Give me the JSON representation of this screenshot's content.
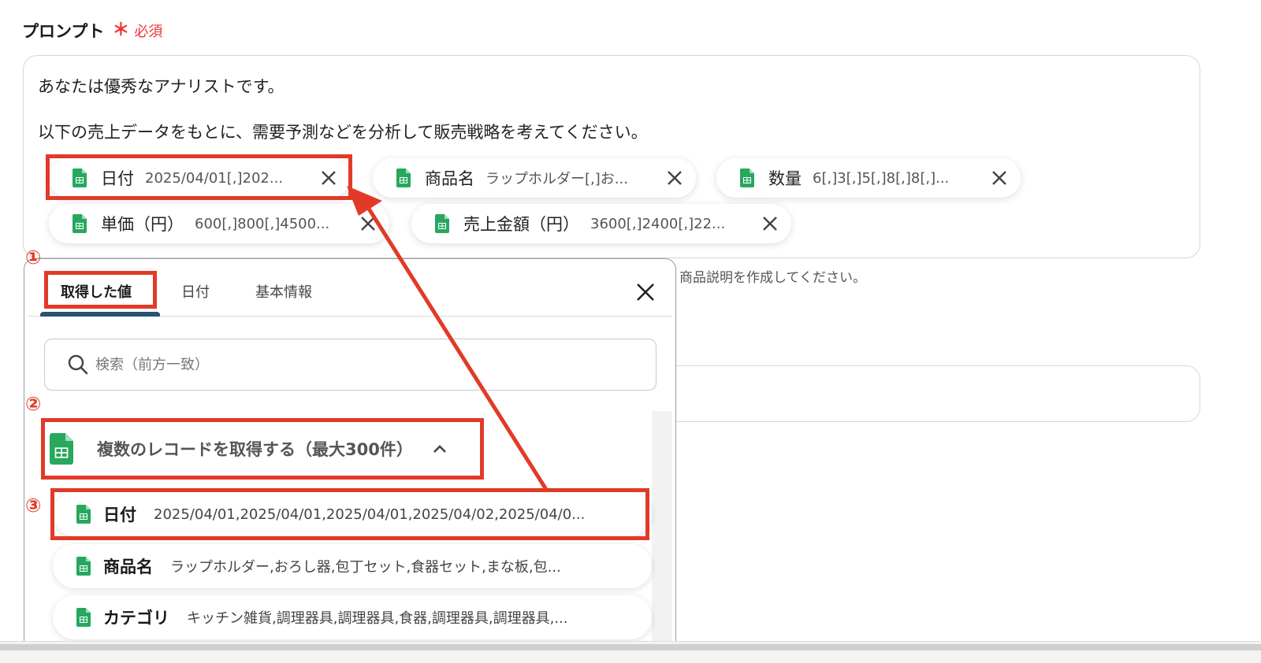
{
  "field": {
    "label": "プロンプト",
    "required_star": "＊",
    "required_text": "必須"
  },
  "prompt": {
    "line1": "あなたは優秀なアナリストです。",
    "line2": "以下の売上データをもとに、需要予測などを分析して販売戦略を考えてください。"
  },
  "chips": [
    {
      "name": "日付",
      "value": "2025/04/01[,]202..."
    },
    {
      "name": "商品名",
      "value": "ラップホルダー[,]お..."
    },
    {
      "name": "数量",
      "value": "6[,]3[,]5[,]8[,]8[,]..."
    },
    {
      "name": "単価（円）",
      "value": "600[,]800[,]4500..."
    },
    {
      "name": "売上金額（円）",
      "value": "3600[,]2400[,]22..."
    }
  ],
  "hint_text": "商品説明を作成してください。",
  "panel": {
    "tabs": [
      "取得した値",
      "日付",
      "基本情報"
    ],
    "search_placeholder": "検索（前方一致）",
    "group_title": "複数のレコードを取得する（最大300件）",
    "items": [
      {
        "name": "日付",
        "value": "2025/04/01,2025/04/01,2025/04/01,2025/04/02,2025/04/0..."
      },
      {
        "name": "商品名",
        "value": "ラップホルダー,おろし器,包丁セット,食器セット,まな板,包..."
      },
      {
        "name": "カテゴリ",
        "value": "キッチン雑貨,調理器具,調理器具,食器,調理器具,調理器具,..."
      }
    ]
  },
  "annotations": [
    "①",
    "②",
    "③"
  ],
  "colors": {
    "accent_red": "#e23a28",
    "sheets_green": "#27a85e",
    "tab_underline": "#28536b",
    "required_red": "#e33333"
  },
  "icons": [
    "google-sheets-icon",
    "close-icon",
    "search-icon",
    "chevron-up-icon"
  ]
}
